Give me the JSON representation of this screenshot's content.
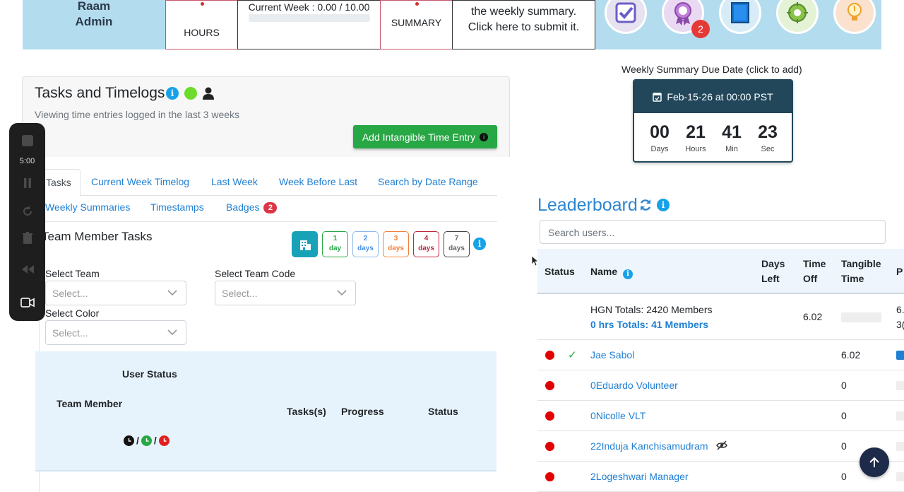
{
  "banner": {
    "user_name": "Raam\nAdmin",
    "hours_label": "HOURS",
    "week_label": "Current Week : 0.00 / 10.00",
    "week_progress": 0,
    "summary_label": "SUMMARY",
    "submit_text": "the weekly summary. Click here to submit it.",
    "badge_count": "2",
    "badge_icons": [
      "criteria-badge-icon",
      "earned-badge-icon",
      "record-badge-icon",
      "app-bug-badge-icon",
      "development-badge-icon"
    ]
  },
  "tasks": {
    "title": "Tasks and Timelogs",
    "subtitle": "Viewing time entries logged in the last 3 weeks",
    "add_button": "Add Intangible Time Entry",
    "info_glyph": "i",
    "tabs": {
      "tasks": "Tasks",
      "current_week": "Current Week Timelog",
      "last_week": "Last Week",
      "week_before_last": "Week Before Last",
      "search_range": "Search by Date Range",
      "weekly_summaries": "Weekly Summaries",
      "timestamps": "Timestamps",
      "badges": "Badges",
      "badges_count": "2"
    },
    "section_title": "Team Member Tasks",
    "day_filters": [
      {
        "num": "1",
        "unit": "day"
      },
      {
        "num": "2",
        "unit": "days"
      },
      {
        "num": "3",
        "unit": "days"
      },
      {
        "num": "4",
        "unit": "days"
      },
      {
        "num": "7",
        "unit": "days"
      }
    ],
    "filters": {
      "team_label": "Select Team",
      "team_placeholder": "Select...",
      "team_code_label": "Select Team Code",
      "team_code_placeholder": "Select...",
      "color_label": "Select Color",
      "color_placeholder": "Select..."
    },
    "table": {
      "user_status": "User Status",
      "team_member": "Team Member",
      "tasks": "Tasks(s)",
      "progress": "Progress",
      "status": "Status",
      "slash": "/"
    }
  },
  "recorder": {
    "time": "5:00"
  },
  "due": {
    "label": "Weekly Summary Due Date (click to add)",
    "date": "Feb-15-26 at 00:00 PST",
    "days": "00",
    "days_unit": "Days",
    "hours": "21",
    "hours_unit": "Hours",
    "min": "41",
    "min_unit": "Min",
    "sec": "23",
    "sec_unit": "Sec"
  },
  "leaderboard": {
    "title": "Leaderboard",
    "search_placeholder": "Search users...",
    "headers": {
      "status": "Status",
      "name": "Name",
      "days_left": "Days\nLeft",
      "time_off": "Time\nOff",
      "tangible": "Tangible\nTime",
      "next": "P"
    },
    "totals": {
      "line1": "HGN Totals: 2420 Members",
      "line2": "0 hrs Totals: 41 Members",
      "time_off": "6.02",
      "next_a": "6.",
      "next_b": "3("
    },
    "rows": [
      {
        "name": "Jae Sabol",
        "value": "6.02",
        "check": "✓"
      },
      {
        "name": "0Eduardo Volunteer",
        "value": "0"
      },
      {
        "name": "0Nicolle VLT",
        "value": "0"
      },
      {
        "name": "22Induja Kanchisamudram",
        "value": "0"
      },
      {
        "name": "2Logeshwari Manager",
        "value": "0"
      }
    ]
  }
}
